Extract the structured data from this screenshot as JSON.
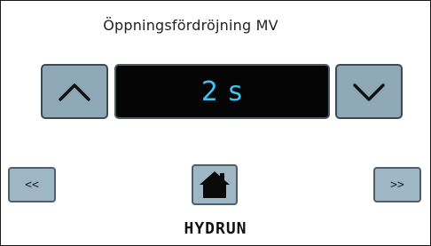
{
  "header": {
    "title": "Öppningsfördröjning MV"
  },
  "value_display": {
    "value": "2 s",
    "text_color": "#3ec4ee"
  },
  "controls": {
    "increase_icon": "chevron-up-icon",
    "decrease_icon": "chevron-down-icon",
    "prev_label": "<<",
    "next_label": ">>",
    "home_icon": "home-icon"
  },
  "footer": {
    "brand": "HYDRUN"
  },
  "colors": {
    "button_fill": "#9fb6c4",
    "button_border": "#4f606c",
    "display_bg": "#050505"
  }
}
